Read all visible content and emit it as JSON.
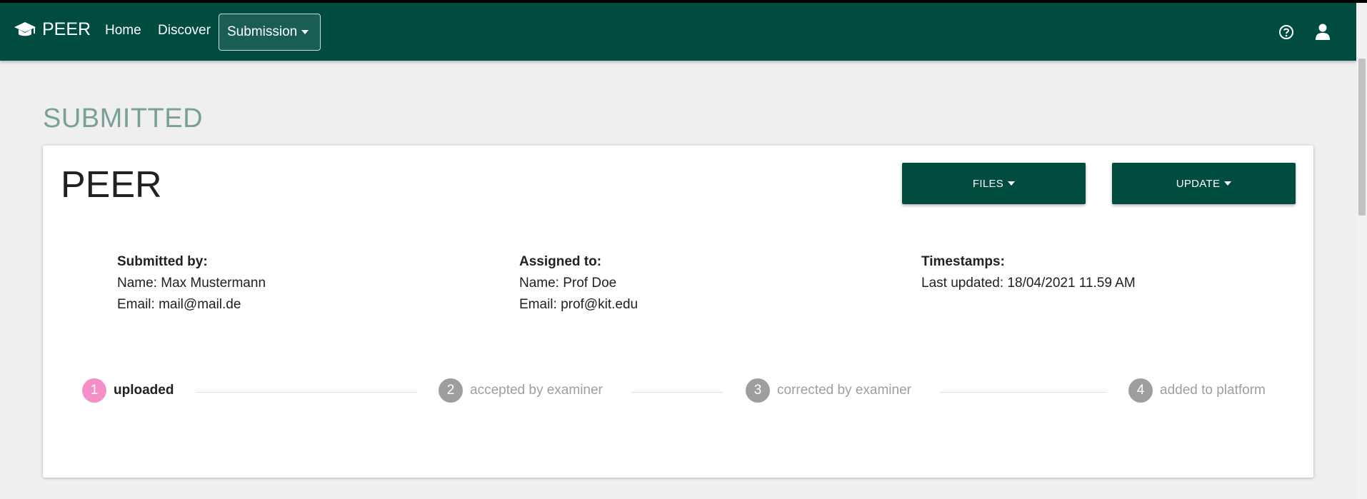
{
  "navbar": {
    "brand": "PEER",
    "links": {
      "home": "Home",
      "discover": "Discover"
    },
    "submission_dropdown": "Submission",
    "icons": {
      "brand": "graduation-cap-icon",
      "help": "question-circle-icon",
      "user": "user-icon"
    }
  },
  "page": {
    "title": "SUBMITTED"
  },
  "card": {
    "title": "PEER",
    "files_button": "FILES",
    "update_button": "UPDATE",
    "submitted_by": {
      "heading": "Submitted by:",
      "name": "Name: Max Mustermann",
      "email": "Email: mail@mail.de"
    },
    "assigned_to": {
      "heading": "Assigned to:",
      "name": "Name: Prof Doe",
      "email": "Email: prof@kit.edu"
    },
    "timestamps": {
      "heading": "Timestamps:",
      "last_updated": "Last updated: 18/04/2021 11.59 AM"
    },
    "steps": [
      {
        "number": "1",
        "label": "uploaded",
        "active": true
      },
      {
        "number": "2",
        "label": "accepted by examiner",
        "active": false
      },
      {
        "number": "3",
        "label": "corrected by examiner",
        "active": false
      },
      {
        "number": "4",
        "label": "added to platform",
        "active": false
      }
    ]
  },
  "colors": {
    "navbar": "#004d40",
    "button": "#004d40",
    "active_step": "#f48fc8",
    "inactive_step": "#9e9e9e",
    "title": "#7a9f99"
  }
}
